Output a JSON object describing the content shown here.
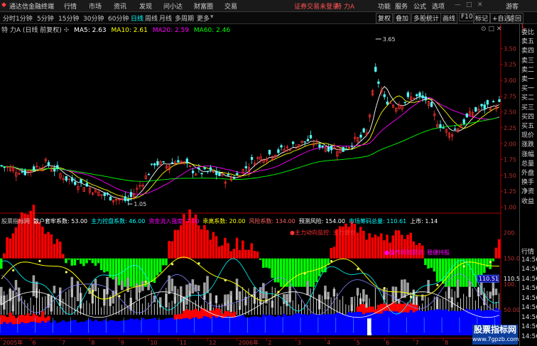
{
  "menubar": {
    "app_title": "通达信金融终端",
    "menus": [
      "行情",
      "市场",
      "资讯",
      "发现",
      "问小达",
      "财富圈",
      "交易"
    ],
    "login_notice": "证券交易未登录",
    "stock_tab": "特 力A",
    "right_items": [
      "功能",
      "服务",
      "公式",
      "选项",
      "游客"
    ],
    "window_buttons": [
      "—",
      "□",
      "✕"
    ]
  },
  "periods": {
    "items": [
      "分时",
      "1分钟",
      "5分钟",
      "15分钟",
      "30分钟",
      "60分钟",
      "日线",
      "周线",
      "月线",
      "多周期",
      "更多"
    ],
    "active": "日线"
  },
  "toolbar": {
    "buttons": [
      "复权",
      "叠加",
      "多股",
      "统计",
      "画线",
      "F10",
      "标记",
      "+自选",
      "返回"
    ]
  },
  "main_chart": {
    "title": "特 力A (日线 前复权)",
    "ma_labels": [
      {
        "text": "MA5: 2.63",
        "color": "#ffffff"
      },
      {
        "text": "MA10: 2.61",
        "color": "#ffff00"
      },
      {
        "text": "MA20: 2.59",
        "color": "#ff00ff"
      },
      {
        "text": "MA60: 2.46",
        "color": "#00ff00"
      }
    ],
    "high_label": "3.65",
    "low_label": "1.05",
    "y_ticks": [
      "3.50",
      "3.25",
      "3.00",
      "2.75",
      "2.50",
      "2.25",
      "2.00",
      "1.75",
      "1.50",
      "1.25",
      "1.00"
    ],
    "up_color": "#ff3232",
    "down_color": "#54ffff"
  },
  "indicator": {
    "header_items": [
      {
        "text": "股票指标网",
        "color": "#c8c8c8"
      },
      {
        "text": "散户套牢系数: 53.00",
        "color": "#ffffff"
      },
      {
        "text": "主力控盘系数: 46.00",
        "color": "#00ffff"
      },
      {
        "text": "资金流入强度: 7.00",
        "color": "#ff00ff"
      },
      {
        "text": "乖离系数: 20.00",
        "color": "#ffff00"
      },
      {
        "text": "风险系数: 134.00",
        "color": "#ff6060"
      },
      {
        "text": "预测风险: 154.00",
        "color": "#ffffff"
      },
      {
        "text": "市场筹码总量: 110.61",
        "color": "#00ffff"
      },
      {
        "text": "上市: 1.14",
        "color": "#ffffff"
      }
    ],
    "note1": "●主力动向监控: 主力增仓",
    "note2": "●操作风险提示: 稳健持股",
    "y_ticks": [
      "200.",
      "150.00",
      "110.51",
      "100.",
      "50.00"
    ],
    "current_value": "110.51",
    "bar_colors": {
      "red": "#ff0000",
      "green": "#00ff00",
      "blue": "#0000ff",
      "gray": "#a0a0a0",
      "white": "#ffffff"
    }
  },
  "x_axis": {
    "labels": [
      "2005年",
      "6",
      "7",
      "8",
      "9",
      "10",
      "11",
      "12",
      "2006年",
      "2",
      "3",
      "4",
      "5",
      "6",
      "7",
      "8",
      "9"
    ]
  },
  "right_panel": {
    "price_tag": "L",
    "quote_labels": [
      "委比",
      "卖五",
      "卖四",
      "卖三",
      "卖二",
      "卖一",
      "买一",
      "买二",
      "买三",
      "买四",
      "买五",
      "现价",
      "涨跌",
      "涨幅",
      "总量",
      "外盘",
      "换手",
      "净资",
      "收益"
    ],
    "times": [
      "行情",
      "14:56",
      "14:56",
      "14:56",
      "14:56",
      "14:56",
      "14:56",
      "14:56",
      "14:56",
      "14:56"
    ]
  },
  "watermark": {
    "line1": "股票指标网",
    "line2": "www.7gpzb.com"
  }
}
